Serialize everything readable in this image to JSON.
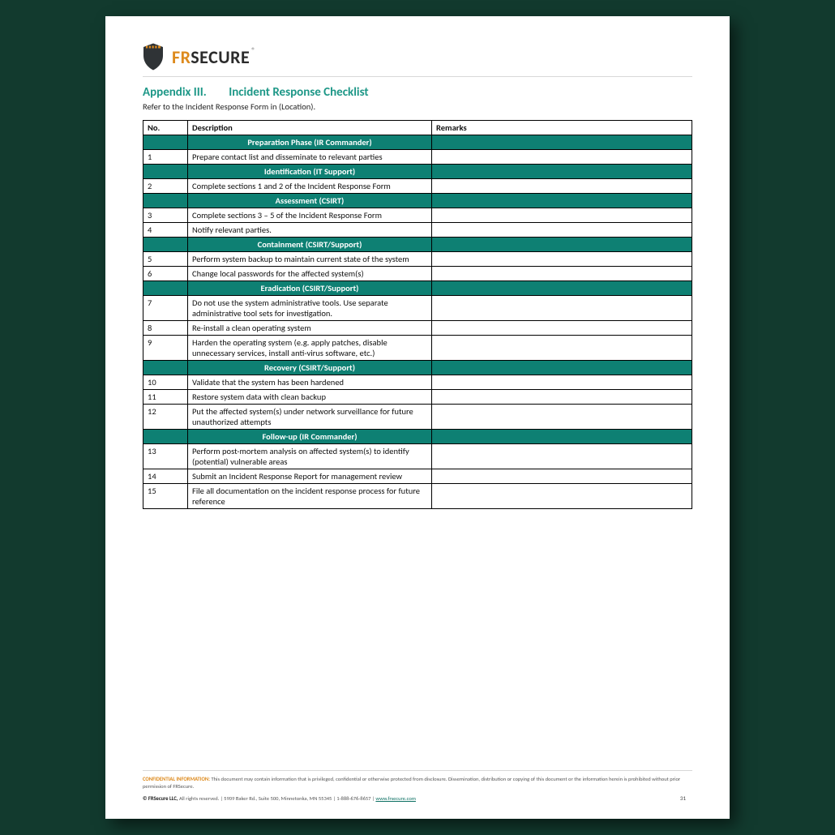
{
  "brand": {
    "fr": "FR",
    "secure": "SECURE",
    "reg": "®"
  },
  "title": {
    "appendix": "Appendix III.",
    "name": "Incident Response Checklist"
  },
  "subtitle": "Refer to the Incident Response Form in (Location).",
  "headers": {
    "no": "No.",
    "desc": "Description",
    "rem": "Remarks"
  },
  "rows": [
    {
      "type": "section",
      "label": "Preparation Phase (IR Commander)"
    },
    {
      "type": "item",
      "no": "1",
      "desc": "Prepare contact list and disseminate to relevant parties",
      "rem": ""
    },
    {
      "type": "section",
      "label": "Identification (IT Support)"
    },
    {
      "type": "item",
      "no": "2",
      "desc": "Complete sections 1 and 2 of the Incident Response Form",
      "rem": ""
    },
    {
      "type": "section",
      "label": "Assessment (CSIRT)"
    },
    {
      "type": "item",
      "no": "3",
      "desc": "Complete sections 3 – 5 of the Incident Response Form",
      "rem": ""
    },
    {
      "type": "item",
      "no": "4",
      "desc": "Notify relevant parties.",
      "rem": ""
    },
    {
      "type": "section",
      "label": "Containment (CSIRT/Support)"
    },
    {
      "type": "item",
      "no": "5",
      "desc": "Perform system backup to maintain current state of the system",
      "rem": ""
    },
    {
      "type": "item",
      "no": "6",
      "desc": "Change local passwords for the affected system(s)",
      "rem": ""
    },
    {
      "type": "section",
      "label": "Eradication (CSIRT/Support)"
    },
    {
      "type": "item",
      "no": "7",
      "desc": "Do not use the system administrative tools. Use separate administrative tool sets for investigation.",
      "rem": ""
    },
    {
      "type": "item",
      "no": "8",
      "desc": "Re-install a clean operating system",
      "rem": ""
    },
    {
      "type": "item",
      "no": "9",
      "desc": "Harden the operating system (e.g. apply patches, disable unnecessary services, install anti-virus software, etc.)",
      "rem": ""
    },
    {
      "type": "section",
      "label": "Recovery (CSIRT/Support)"
    },
    {
      "type": "item",
      "no": "10",
      "desc": "Validate that the system has been hardened",
      "rem": ""
    },
    {
      "type": "item",
      "no": "11",
      "desc": "Restore system data with clean backup",
      "rem": ""
    },
    {
      "type": "item",
      "no": "12",
      "desc": "Put the affected system(s) under network surveillance for future unauthorized attempts",
      "rem": ""
    },
    {
      "type": "section",
      "label": "Follow-up (IR Commander)"
    },
    {
      "type": "item",
      "no": "13",
      "desc": "Perform post-mortem analysis on affected system(s) to identify (potential) vulnerable areas",
      "rem": ""
    },
    {
      "type": "item",
      "no": "14",
      "desc": "Submit an Incident Response Report for management review",
      "rem": ""
    },
    {
      "type": "item",
      "no": "15",
      "desc": "File all documentation on the incident response process for future reference",
      "rem": ""
    }
  ],
  "footer": {
    "conf_label": "CONFIDENTIAL INFORMATION:",
    "conf_text": " This document may contain information that is privileged, confidential or otherwise protected from disclosure. Dissemination, distribution or copying of this document or the information herein is prohibited without prior permission of FRSecure.",
    "copy": "© FRSecure LLC,",
    "rights": " All rights reserved. | 5909 Baker Rd., Suite 500, Minnetonka, MN 55345 | 1-888-676-8657 | ",
    "link": "www.frsecure.com",
    "page": "31"
  }
}
